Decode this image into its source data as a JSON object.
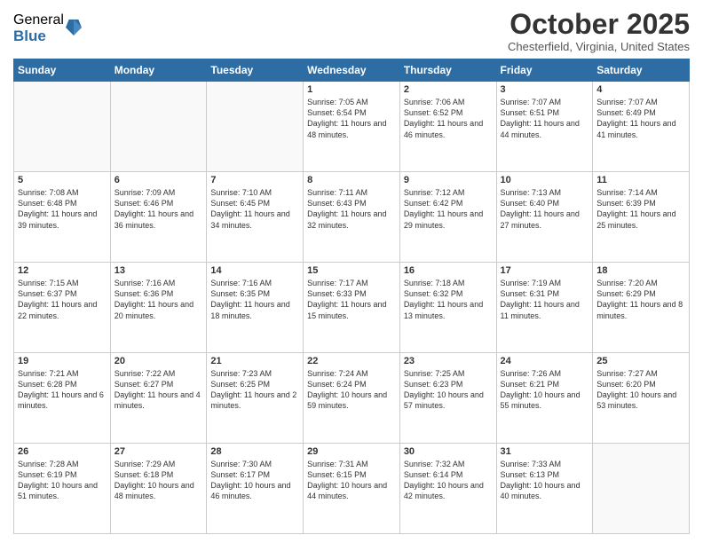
{
  "header": {
    "logo_general": "General",
    "logo_blue": "Blue",
    "title": "October 2025",
    "location": "Chesterfield, Virginia, United States"
  },
  "days_of_week": [
    "Sunday",
    "Monday",
    "Tuesday",
    "Wednesday",
    "Thursday",
    "Friday",
    "Saturday"
  ],
  "weeks": [
    [
      {
        "day": "",
        "info": ""
      },
      {
        "day": "",
        "info": ""
      },
      {
        "day": "",
        "info": ""
      },
      {
        "day": "1",
        "info": "Sunrise: 7:05 AM\nSunset: 6:54 PM\nDaylight: 11 hours and 48 minutes."
      },
      {
        "day": "2",
        "info": "Sunrise: 7:06 AM\nSunset: 6:52 PM\nDaylight: 11 hours and 46 minutes."
      },
      {
        "day": "3",
        "info": "Sunrise: 7:07 AM\nSunset: 6:51 PM\nDaylight: 11 hours and 44 minutes."
      },
      {
        "day": "4",
        "info": "Sunrise: 7:07 AM\nSunset: 6:49 PM\nDaylight: 11 hours and 41 minutes."
      }
    ],
    [
      {
        "day": "5",
        "info": "Sunrise: 7:08 AM\nSunset: 6:48 PM\nDaylight: 11 hours and 39 minutes."
      },
      {
        "day": "6",
        "info": "Sunrise: 7:09 AM\nSunset: 6:46 PM\nDaylight: 11 hours and 36 minutes."
      },
      {
        "day": "7",
        "info": "Sunrise: 7:10 AM\nSunset: 6:45 PM\nDaylight: 11 hours and 34 minutes."
      },
      {
        "day": "8",
        "info": "Sunrise: 7:11 AM\nSunset: 6:43 PM\nDaylight: 11 hours and 32 minutes."
      },
      {
        "day": "9",
        "info": "Sunrise: 7:12 AM\nSunset: 6:42 PM\nDaylight: 11 hours and 29 minutes."
      },
      {
        "day": "10",
        "info": "Sunrise: 7:13 AM\nSunset: 6:40 PM\nDaylight: 11 hours and 27 minutes."
      },
      {
        "day": "11",
        "info": "Sunrise: 7:14 AM\nSunset: 6:39 PM\nDaylight: 11 hours and 25 minutes."
      }
    ],
    [
      {
        "day": "12",
        "info": "Sunrise: 7:15 AM\nSunset: 6:37 PM\nDaylight: 11 hours and 22 minutes."
      },
      {
        "day": "13",
        "info": "Sunrise: 7:16 AM\nSunset: 6:36 PM\nDaylight: 11 hours and 20 minutes."
      },
      {
        "day": "14",
        "info": "Sunrise: 7:16 AM\nSunset: 6:35 PM\nDaylight: 11 hours and 18 minutes."
      },
      {
        "day": "15",
        "info": "Sunrise: 7:17 AM\nSunset: 6:33 PM\nDaylight: 11 hours and 15 minutes."
      },
      {
        "day": "16",
        "info": "Sunrise: 7:18 AM\nSunset: 6:32 PM\nDaylight: 11 hours and 13 minutes."
      },
      {
        "day": "17",
        "info": "Sunrise: 7:19 AM\nSunset: 6:31 PM\nDaylight: 11 hours and 11 minutes."
      },
      {
        "day": "18",
        "info": "Sunrise: 7:20 AM\nSunset: 6:29 PM\nDaylight: 11 hours and 8 minutes."
      }
    ],
    [
      {
        "day": "19",
        "info": "Sunrise: 7:21 AM\nSunset: 6:28 PM\nDaylight: 11 hours and 6 minutes."
      },
      {
        "day": "20",
        "info": "Sunrise: 7:22 AM\nSunset: 6:27 PM\nDaylight: 11 hours and 4 minutes."
      },
      {
        "day": "21",
        "info": "Sunrise: 7:23 AM\nSunset: 6:25 PM\nDaylight: 11 hours and 2 minutes."
      },
      {
        "day": "22",
        "info": "Sunrise: 7:24 AM\nSunset: 6:24 PM\nDaylight: 10 hours and 59 minutes."
      },
      {
        "day": "23",
        "info": "Sunrise: 7:25 AM\nSunset: 6:23 PM\nDaylight: 10 hours and 57 minutes."
      },
      {
        "day": "24",
        "info": "Sunrise: 7:26 AM\nSunset: 6:21 PM\nDaylight: 10 hours and 55 minutes."
      },
      {
        "day": "25",
        "info": "Sunrise: 7:27 AM\nSunset: 6:20 PM\nDaylight: 10 hours and 53 minutes."
      }
    ],
    [
      {
        "day": "26",
        "info": "Sunrise: 7:28 AM\nSunset: 6:19 PM\nDaylight: 10 hours and 51 minutes."
      },
      {
        "day": "27",
        "info": "Sunrise: 7:29 AM\nSunset: 6:18 PM\nDaylight: 10 hours and 48 minutes."
      },
      {
        "day": "28",
        "info": "Sunrise: 7:30 AM\nSunset: 6:17 PM\nDaylight: 10 hours and 46 minutes."
      },
      {
        "day": "29",
        "info": "Sunrise: 7:31 AM\nSunset: 6:15 PM\nDaylight: 10 hours and 44 minutes."
      },
      {
        "day": "30",
        "info": "Sunrise: 7:32 AM\nSunset: 6:14 PM\nDaylight: 10 hours and 42 minutes."
      },
      {
        "day": "31",
        "info": "Sunrise: 7:33 AM\nSunset: 6:13 PM\nDaylight: 10 hours and 40 minutes."
      },
      {
        "day": "",
        "info": ""
      }
    ]
  ]
}
